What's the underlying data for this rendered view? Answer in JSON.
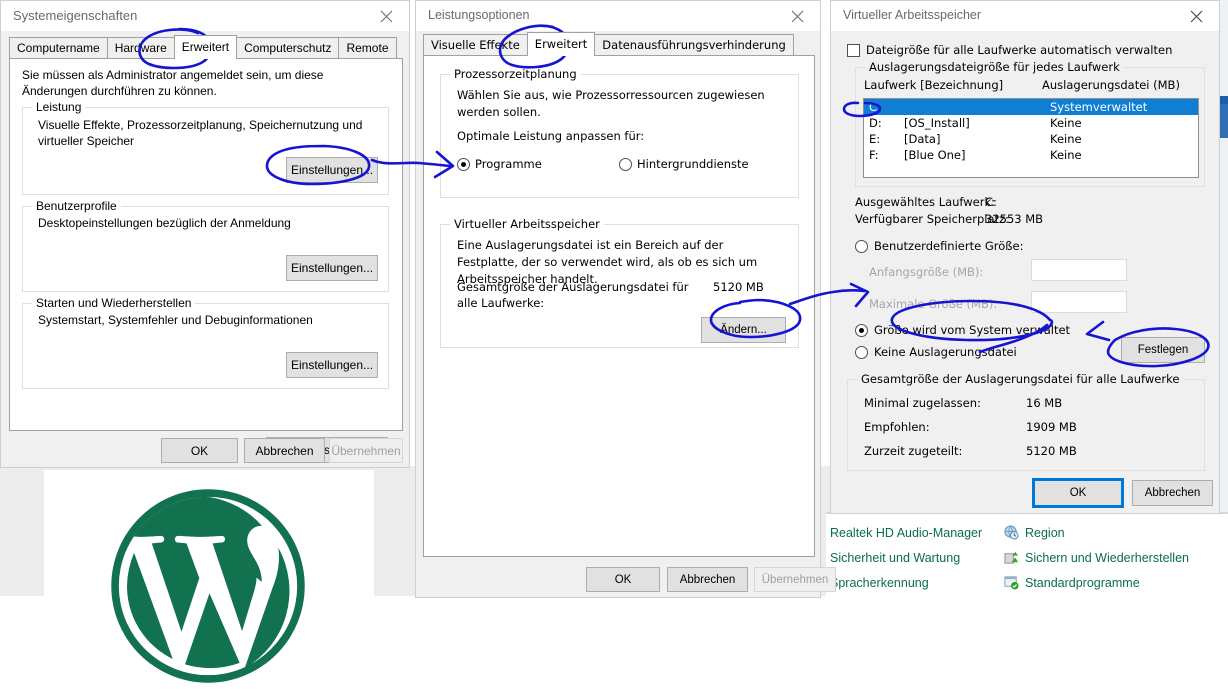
{
  "background": {
    "logo_name": "wordpress-logo",
    "logo_color": "#12714e",
    "control_panel": {
      "left_items": [
        {
          "label": "Realtek HD Audio-Manager"
        },
        {
          "label": "Sicherheit und Wartung"
        },
        {
          "label": "Spracherkennung"
        }
      ],
      "right_items": [
        {
          "label": "Region",
          "icon": "globe-clock-icon"
        },
        {
          "label": "Sichern und Wiederherstellen",
          "icon": "backup-icon"
        },
        {
          "label": "Standardprogramme",
          "icon": "default-programs-icon"
        }
      ],
      "link_color": "#0a6e49"
    }
  },
  "system_properties": {
    "title": "Systemeigenschaften",
    "close_label": "Schließen",
    "tabs": [
      {
        "label": "Computername",
        "active": false
      },
      {
        "label": "Hardware",
        "active": false
      },
      {
        "label": "Erweitert",
        "active": true
      },
      {
        "label": "Computerschutz",
        "active": false
      },
      {
        "label": "Remote",
        "active": false
      }
    ],
    "admin_note": "Sie müssen als Administrator angemeldet sein, um diese Änderungen durchführen zu können.",
    "groups": [
      {
        "title": "Leistung",
        "description": "Visuelle Effekte, Prozessorzeitplanung, Speichernutzung und virtueller Speicher",
        "button": "Einstellungen..."
      },
      {
        "title": "Benutzerprofile",
        "description": "Desktopeinstellungen bezüglich der Anmeldung",
        "button": "Einstellungen..."
      },
      {
        "title": "Starten und Wiederherstellen",
        "description": "Systemstart, Systemfehler und Debuginformationen",
        "button": "Einstellungen..."
      }
    ],
    "env_button": "Umgebungsvariablen...",
    "footer": {
      "ok": "OK",
      "cancel": "Abbrechen",
      "apply": "Übernehmen",
      "apply_disabled": true
    }
  },
  "performance_options": {
    "title": "Leistungsoptionen",
    "close_label": "Schließen",
    "tabs": [
      {
        "label": "Visuelle Effekte",
        "active": false
      },
      {
        "label": "Erweitert",
        "active": true
      },
      {
        "label": "Datenausführungsverhinderung",
        "active": false
      }
    ],
    "processor_group": {
      "title": "Prozessorzeitplanung",
      "description": "Wählen Sie aus, wie Prozessorressourcen zugewiesen werden sollen.",
      "subtitle": "Optimale Leistung anpassen für:",
      "options": [
        {
          "label": "Programme",
          "selected": true
        },
        {
          "label": "Hintergrunddienste",
          "selected": false
        }
      ]
    },
    "virtual_memory_group": {
      "title": "Virtueller Arbeitsspeicher",
      "description": "Eine Auslagerungsdatei ist ein Bereich auf der Festplatte, der so verwendet wird, als ob es sich um Arbeitsspeicher handelt.",
      "total_label_line1": "Gesamtgröße der Auslagerungsdatei für",
      "total_label_line2": "alle Laufwerke:",
      "total_value": "5120 MB",
      "change_button": "Ändern..."
    },
    "footer": {
      "ok": "OK",
      "cancel": "Abbrechen",
      "apply": "Übernehmen",
      "apply_disabled": true
    }
  },
  "virtual_memory": {
    "title": "Virtueller Arbeitsspeicher",
    "close_label": "Schließen",
    "auto_manage": {
      "label": "Dateigröße für alle Laufwerke automatisch verwalten",
      "checked": false
    },
    "drive_group_title": "Auslagerungsdateigröße für jedes Laufwerk",
    "columns": {
      "drive": "Laufwerk [Bezeichnung]",
      "pagefile": "Auslagerungsdatei (MB)"
    },
    "drives": [
      {
        "drive": "C:",
        "label": "",
        "pagefile": "Systemverwaltet",
        "selected": true
      },
      {
        "drive": "D:",
        "label": "[OS_Install]",
        "pagefile": "Keine",
        "selected": false
      },
      {
        "drive": "E:",
        "label": "[Data]",
        "pagefile": "Keine",
        "selected": false
      },
      {
        "drive": "F:",
        "label": "[Blue One]",
        "pagefile": "Keine",
        "selected": false
      }
    ],
    "selected_drive_label": "Ausgewähltes Laufwerk:",
    "selected_drive_value": "C:",
    "free_space_label": "Verfügbarer Speicherplatz:",
    "free_space_value": "32553 MB",
    "size_options": [
      {
        "label": "Benutzerdefinierte Größe:",
        "selected": false
      },
      {
        "label": "Größe wird vom System verwaltet",
        "selected": true
      },
      {
        "label": "Keine Auslagerungsdatei",
        "selected": false
      }
    ],
    "initial_size_label": "Anfangsgröße (MB):",
    "initial_size_value": "",
    "max_size_label": "Maximale Größe (MB):",
    "max_size_value": "",
    "set_button": "Festlegen",
    "summary": {
      "title": "Gesamtgröße der Auslagerungsdatei für alle Laufwerke",
      "rows": [
        {
          "label": "Minimal zugelassen:",
          "value": "16 MB"
        },
        {
          "label": "Empfohlen:",
          "value": "1909 MB"
        },
        {
          "label": "Zurzeit zugeteilt:",
          "value": "5120 MB"
        }
      ]
    },
    "footer": {
      "ok": "OK",
      "cancel": "Abbrechen",
      "ok_focused": true
    }
  },
  "annotations": {
    "ink_color": "#1414d2",
    "marks": [
      {
        "name": "circle-tab-erweitert-sysprops",
        "kind": "ellipse"
      },
      {
        "name": "circle-einstellungen-leistung",
        "kind": "ellipse"
      },
      {
        "name": "arrow-einstellungen-to-programme",
        "kind": "arrow"
      },
      {
        "name": "circle-tab-erweitert-perfopts",
        "kind": "ellipse"
      },
      {
        "name": "circle-aendern-button",
        "kind": "ellipse"
      },
      {
        "name": "arrow-aendern-to-vmdialog",
        "kind": "arrow"
      },
      {
        "name": "circle-drive-c",
        "kind": "ellipse"
      },
      {
        "name": "circle-systemmanaged-radio",
        "kind": "ellipse"
      },
      {
        "name": "circle-festlegen-button",
        "kind": "ellipse"
      },
      {
        "name": "arrow-systemmanaged-to-festlegen",
        "kind": "arrow"
      }
    ]
  }
}
